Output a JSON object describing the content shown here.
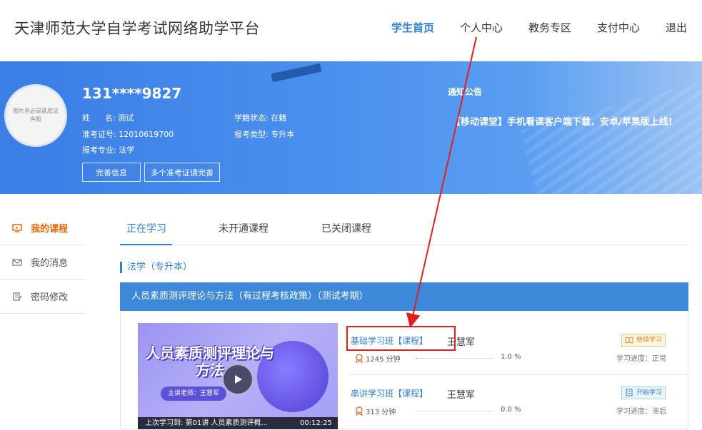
{
  "header": {
    "site_title": "天津师范大学自学考试网络助学平台",
    "nav": [
      {
        "label": "学生首页",
        "active": true
      },
      {
        "label": "个人中心"
      },
      {
        "label": "教务专区"
      },
      {
        "label": "支付中心"
      },
      {
        "label": "退出"
      }
    ]
  },
  "profile": {
    "avatar_text": "图片务必是蓝底证件照",
    "user_id": "131****9827",
    "name_label": "姓      名:",
    "name": "测试",
    "ticket_label": "准考证号:",
    "ticket": "12010619700",
    "major_label": "报考专业:",
    "major": "法学",
    "status_label": "学籍状态:",
    "status": "在籍",
    "type_label": "报考类型:",
    "type": "专升本",
    "btn_complete": "完善信息",
    "btn_tickets": "多个准考证请完善"
  },
  "notice": {
    "title": "通知公告",
    "text": "【移动课堂】手机看课客户端下载，安卓/苹果版上线!"
  },
  "sidebar": {
    "items": [
      {
        "label": "我的课程",
        "icon": "monitor-icon",
        "active": true
      },
      {
        "label": "我的消息",
        "icon": "mail-icon"
      },
      {
        "label": "密码修改",
        "icon": "edit-icon"
      }
    ]
  },
  "tabs": [
    {
      "label": "正在学习",
      "active": true
    },
    {
      "label": "未开通课程"
    },
    {
      "label": "已关闭课程"
    }
  ],
  "section": {
    "label": "法学（专升本）"
  },
  "course": {
    "title": "人员素质测评理论与方法（有过程考核政策）（测试考期）",
    "thumbnail": {
      "title": "人员素质测评理论与方法",
      "teacher_badge": "主讲老师：王慧军",
      "last_study": "上次学习到:   第01讲   人员素质测评概...",
      "time": "00:12:25"
    },
    "classes": [
      {
        "name": "基础学习班【课程】",
        "teacher": "王慧军",
        "duration": "1245 分钟",
        "progress": 1.0,
        "percent": "1.0 %",
        "action": "继续学习",
        "status": "学习进度：正常"
      },
      {
        "name": "串讲学习班【课程】",
        "teacher": "王慧军",
        "duration": "313 分钟",
        "progress": 0.0,
        "percent": "0.0 %",
        "action": "开始学习",
        "status": "学习进度：滞后"
      }
    ]
  },
  "colors": {
    "accent": "#2f7fd6",
    "sidebar_active": "#e8650a",
    "annotation": "#e02020"
  }
}
